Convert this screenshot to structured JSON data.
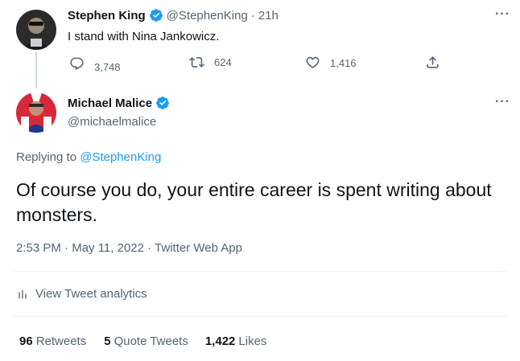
{
  "parent_tweet": {
    "display_name": "Stephen King",
    "handle": "@StephenKing",
    "separator": "·",
    "time_ago": "21h",
    "text": "I stand with Nina Jankowicz.",
    "more_label": "···",
    "actions": {
      "replies": "3,748",
      "retweets": "624",
      "likes": "1,416"
    }
  },
  "main_tweet": {
    "display_name": "Michael Malice",
    "handle": "@michaelmalice",
    "more_label": "···",
    "replying_prefix": "Replying to",
    "replying_handle": "@StephenKing",
    "text": "Of course you do, your entire career is spent writing about monsters.",
    "timestamp": "2:53 PM · May 11, 2022 · Twitter Web App",
    "analytics_label": "View Tweet analytics"
  },
  "stats": {
    "retweets_count": "96",
    "retweets_label": "Retweets",
    "quotes_count": "5",
    "quotes_label": "Quote Tweets",
    "likes_count": "1,422",
    "likes_label": "Likes"
  },
  "colors": {
    "accent": "#1d9bf0",
    "muted": "#536471",
    "text": "#0f1419",
    "divider": "#eff3f4"
  },
  "icons": {
    "verified": "verified-badge-icon",
    "reply": "reply-icon",
    "retweet": "retweet-icon",
    "like": "heart-icon",
    "share": "share-icon",
    "analytics": "analytics-icon",
    "more": "more-icon"
  }
}
